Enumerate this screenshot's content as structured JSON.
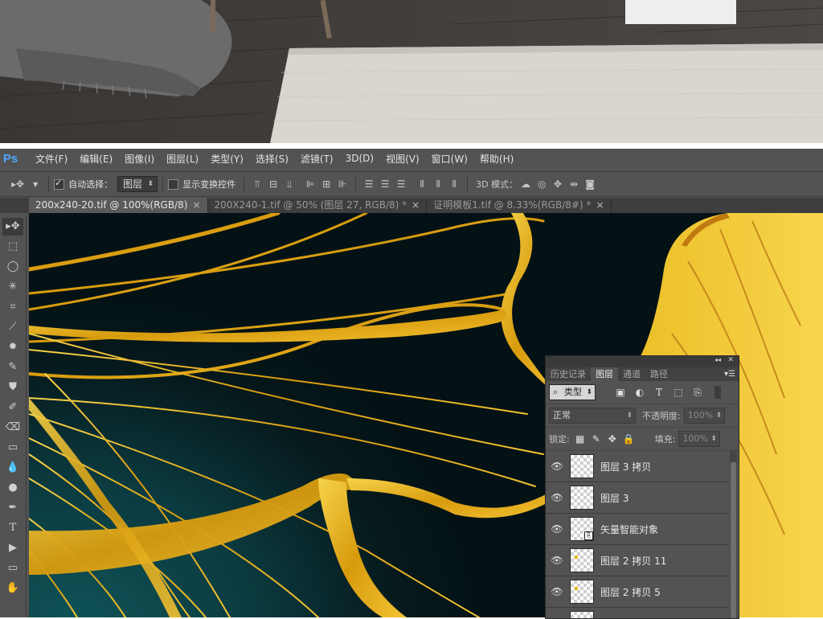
{
  "app": {
    "logo": "Ps"
  },
  "menu": [
    "文件(F)",
    "编辑(E)",
    "图像(I)",
    "图层(L)",
    "类型(Y)",
    "选择(S)",
    "滤镜(T)",
    "3D(D)",
    "视图(V)",
    "窗口(W)",
    "帮助(H)"
  ],
  "options": {
    "auto_select_label": "自动选择：",
    "auto_select_value": "图层",
    "show_transform_label": "显示变换控件",
    "mode_3d_label": "3D 模式："
  },
  "tabs": [
    {
      "label": "200x240-20.tif @ 100%(RGB/8)",
      "close": "×"
    },
    {
      "label": "200X240-1.tif @ 50% (图层 27, RGB/8) *",
      "close": "×"
    },
    {
      "label": "证明模板1.tif @ 8.33%(RGB/8#) *",
      "close": "×"
    }
  ],
  "panel": {
    "tabs": [
      "历史记录",
      "图层",
      "通道",
      "路径"
    ],
    "active_tab": 1,
    "filter_kind": "类型",
    "blend_mode": "正常",
    "opacity_label": "不透明度:",
    "opacity_value": "100%",
    "lock_label": "锁定:",
    "fill_label": "填充:",
    "fill_value": "100%",
    "layers": [
      {
        "name": "图层 3 拷贝",
        "badge": ""
      },
      {
        "name": "图层 3",
        "badge": ""
      },
      {
        "name": "矢量智能对象",
        "badge": "smart"
      },
      {
        "name": "图层 2 拷贝 11",
        "badge": "star"
      },
      {
        "name": "图层 2 拷贝 5",
        "badge": "star"
      },
      {
        "name": "",
        "badge": ""
      }
    ]
  },
  "colors": {
    "ps_blue": "#4fa5ff",
    "ui_gray": "#535353",
    "canvas_teal": "#0b3a3f",
    "gold": "#e2b21c"
  }
}
